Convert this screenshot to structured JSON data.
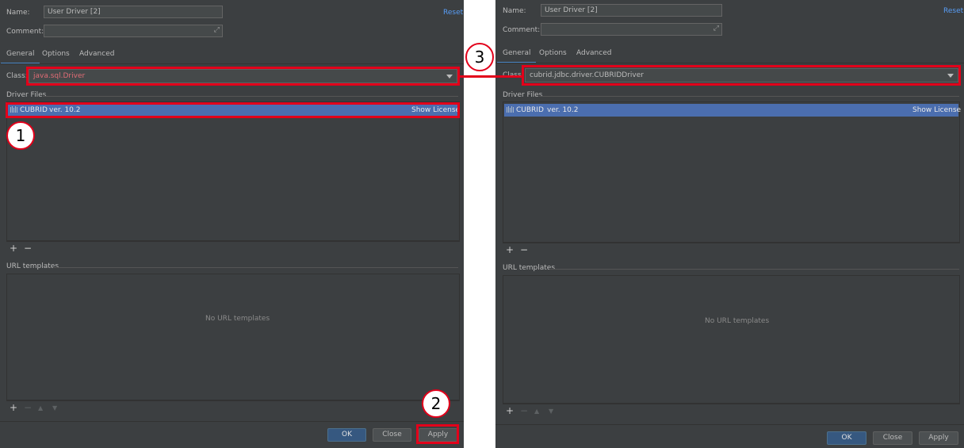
{
  "left": {
    "name_label": "Name:",
    "name_value": "User Driver [2]",
    "reset_label": "Reset",
    "comment_label": "Comment:",
    "comment_value": "",
    "tabs": [
      {
        "label": "General",
        "active": true
      },
      {
        "label": "Options",
        "active": false
      },
      {
        "label": "Advanced",
        "active": false
      }
    ],
    "class_label": "Class:",
    "class_value": "java.sql.Driver",
    "driver_files_title": "Driver Files",
    "driver_files": [
      {
        "name": "CUBRID",
        "version": "ver. 10.2",
        "license_label": "Show License"
      }
    ],
    "url_templates_title": "URL templates",
    "url_templates_empty": "No URL templates",
    "buttons": {
      "ok": "OK",
      "close": "Close",
      "apply": "Apply"
    }
  },
  "right": {
    "name_label": "Name:",
    "name_value": "User Driver [2]",
    "reset_label": "Reset",
    "comment_label": "Comment:",
    "comment_value": "",
    "tabs": [
      {
        "label": "General",
        "active": true
      },
      {
        "label": "Options",
        "active": false
      },
      {
        "label": "Advanced",
        "active": false
      }
    ],
    "class_label": "Class:",
    "class_value": "cubrid.jdbc.driver.CUBRIDDriver",
    "driver_files_title": "Driver Files",
    "driver_files": [
      {
        "name": "CUBRID",
        "version": "ver. 10.2",
        "license_label": "Show License"
      }
    ],
    "url_templates_title": "URL templates",
    "url_templates_empty": "No URL templates",
    "buttons": {
      "ok": "OK",
      "close": "Close",
      "apply": "Apply"
    }
  },
  "annotations": {
    "step1": "1",
    "step2": "2",
    "step3": "3"
  },
  "colors": {
    "panel_bg": "#3c3f41",
    "selection": "#4b6eaf",
    "highlight": "#e2001a",
    "link": "#589df6",
    "error_text": "#e06c75",
    "primary_button": "#365880"
  },
  "icons": {
    "expand": "expand-icon",
    "combo_arrow": "chevron-down-icon",
    "library": "library-icon",
    "add": "plus-icon",
    "remove": "minus-icon",
    "move_up": "arrow-up-icon",
    "move_down": "arrow-down-icon"
  }
}
